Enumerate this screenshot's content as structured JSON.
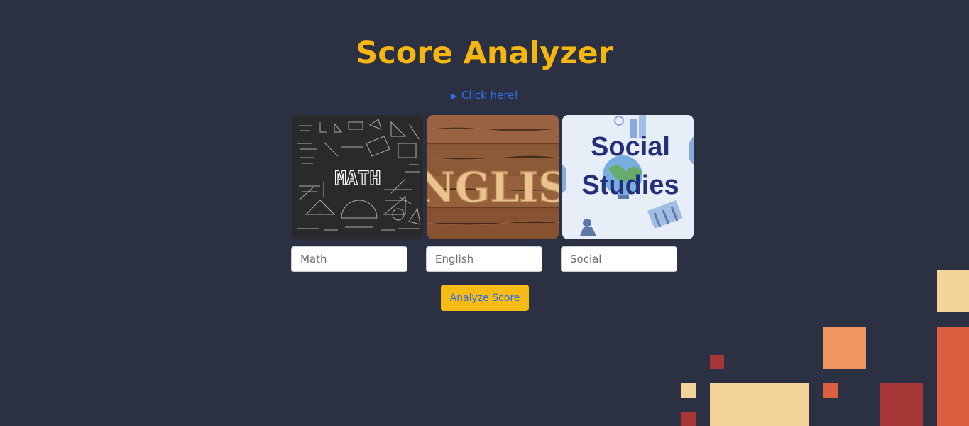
{
  "page": {
    "title": "Score Analyzer"
  },
  "disclosure": {
    "label": "Click here!"
  },
  "cards": {
    "math": {
      "image_text": "MATH"
    },
    "english": {
      "image_text": "NGLIS"
    },
    "social": {
      "line1": "Social",
      "line2": "Studies"
    }
  },
  "inputs": {
    "math": {
      "placeholder": "Math",
      "value": ""
    },
    "english": {
      "placeholder": "English",
      "value": ""
    },
    "social": {
      "placeholder": "Social",
      "value": ""
    }
  },
  "analyze_button": {
    "label": "Analyze Score"
  },
  "colors": {
    "background": "#2b3142",
    "title": "#f5b70f",
    "link": "#2f6fe6",
    "button": "#f7bb15",
    "decor": [
      "#f2d39a",
      "#f09660",
      "#d95f3f",
      "#a63636"
    ]
  }
}
